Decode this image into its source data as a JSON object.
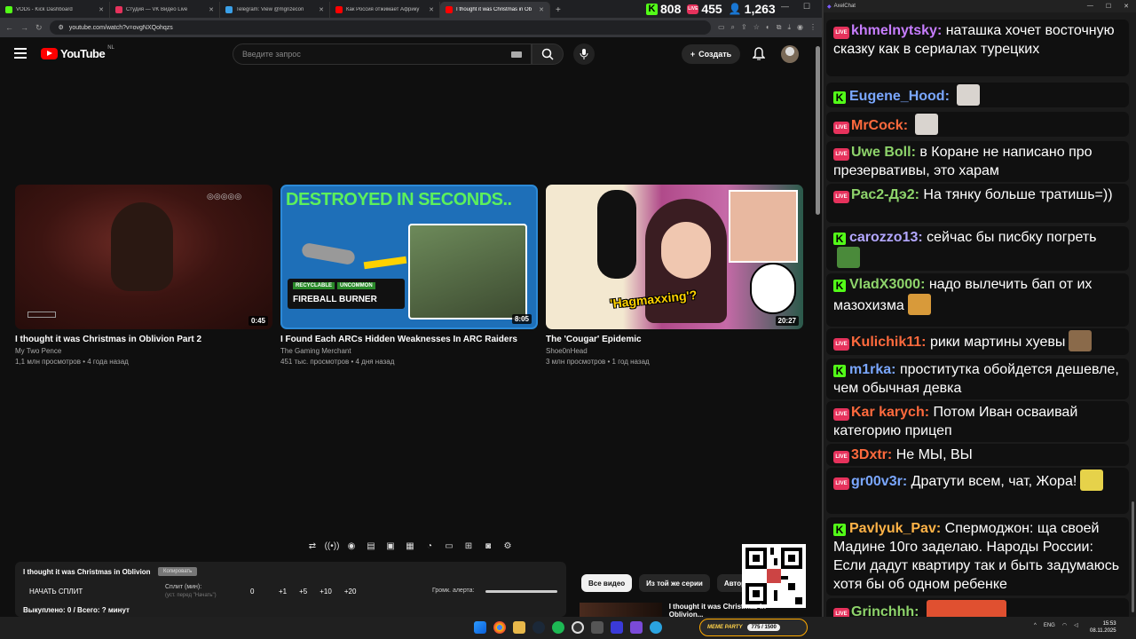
{
  "browser": {
    "tabs": [
      {
        "title": "VODs - Kick Dashboard",
        "fav": "#53fc18",
        "active": false
      },
      {
        "title": "Студия — VK Видео Live",
        "fav": "#e6325c",
        "active": false
      },
      {
        "title": "Telegram: View @mgnzecon",
        "fav": "#3aa0e8",
        "active": false
      },
      {
        "title": "Как Россия отжимает Африку",
        "fav": "#ff0000",
        "active": false
      },
      {
        "title": "I thought it was Christmas in Ob",
        "fav": "#ff0000",
        "active": true
      }
    ],
    "url": "youtube.com/watch?v=ovgNXQohqzs"
  },
  "stream_stats": {
    "kick_viewers": "808",
    "vk_viewers": "455",
    "total_viewers": "1,263"
  },
  "youtube": {
    "logo_text": "YouTube",
    "logo_region": "NL",
    "search_placeholder": "Введите запрос",
    "create_label": "Создать",
    "videos": [
      {
        "title": "I thought it was Christmas in Oblivion Part 2",
        "channel": "My Two Pence",
        "meta": "1,1 млн просмотров • 4 года назад",
        "duration": "0:45"
      },
      {
        "title": "I Found Each ARCs Hidden Weaknesses In ARC Raiders",
        "channel": "The Gaming Merchant",
        "meta": "451 тыс. просмотров • 4 дня назад",
        "duration": "8:05",
        "thumb_headline": "DESTROYED IN SECONDS..",
        "thumb_tag1": "RECYCLABLE",
        "thumb_tag2": "UNCOMMON",
        "thumb_item": "FIREBALL BURNER"
      },
      {
        "title": "The 'Cougar' Epidemic",
        "channel": "Shoe0nHead",
        "meta": "3 млн просмотров • 1 год назад",
        "duration": "20:27",
        "thumb_caption": "'Hagmaxxing'?"
      }
    ],
    "panel": {
      "title": "I thought it was Christmas in Oblivion",
      "copy_label": "Копировать",
      "start_label": "НАЧАТЬ СПЛИТ",
      "split_label": "Сплит (мин):",
      "split_sub": "(уст. перед \"Начать\")",
      "split_value": "0",
      "increments": [
        "+1",
        "+5",
        "+10",
        "+20"
      ],
      "alert_label": "Громк. алерта:",
      "alert_volume": 1.0,
      "bought": "Выкуплено: 0 / Всего: ? минут"
    },
    "chips": [
      "Все видео",
      "Из той же серии",
      "Автор:"
    ],
    "next_title": "I thought it was Christmas in Oblivion..."
  },
  "chat": {
    "app_title": "AxelChat",
    "messages": [
      {
        "platform": "vk",
        "nick": "khmelnytsky",
        "color": "#c77dff",
        "text": "наташка хочет восточную сказку как в сериалах турецких"
      },
      {
        "platform": "kick",
        "nick": "Eugene_Hood",
        "color": "#7aa7ff",
        "text": "",
        "emote": "#d9d4cf"
      },
      {
        "platform": "vk",
        "nick": "MrCock",
        "color": "#ff6a3d",
        "text": "",
        "emote": "#d9d4cf"
      },
      {
        "platform": "vk",
        "nick": "Uwe Boll",
        "color": "#8ed46b",
        "text": "в Коране не написано про презервативы, это харам"
      },
      {
        "platform": "vk",
        "nick": "Рас2-Дэ2",
        "color": "#8ed46b",
        "text": "На тянку больше тратишь=))"
      },
      {
        "platform": "kick",
        "nick": "carozzo13",
        "color": "#b3a7ff",
        "text": "сейчас бы писбку погреть",
        "emote": "#4a8a3a"
      },
      {
        "platform": "kick",
        "nick": "VladX3000",
        "color": "#8ed46b",
        "text": "надо вылечить бап от их мазохизма",
        "emote": "#d89a3a"
      },
      {
        "platform": "vk",
        "nick": "Kulichik11",
        "color": "#ff6a3d",
        "text": "рики мартины хуевы",
        "emote": "#8a6a4a"
      },
      {
        "platform": "kick",
        "nick": "m1rka",
        "color": "#7aa7ff",
        "text": "проститутка обойдется дешевле, чем обычная девка"
      },
      {
        "platform": "vk",
        "nick": "Kar karych",
        "color": "#ff6a3d",
        "text": "Потом Иван осваивай категорию прицеп"
      },
      {
        "platform": "vk",
        "nick": "3Dxtr",
        "color": "#ff6a3d",
        "text": "Не МЫ, ВЫ"
      },
      {
        "platform": "vk",
        "nick": "gr00v3r",
        "color": "#7aa7ff",
        "text": "Дратути всем, чат, Жора!",
        "emote": "#e6d24a"
      },
      {
        "platform": "kick",
        "nick": "Pavlyuk_Pav",
        "color": "#ffb347",
        "text": "Спермоджон: ща своей Мадине 10го заделаю. Народы России: Если дадут квартиру так и быть задумаюсь хотя бы об одном ребенке"
      },
      {
        "platform": "vk",
        "nick": "Grinchhh",
        "color": "#8ed46b",
        "text": "",
        "emote": "#e05030"
      }
    ]
  },
  "taskbar": {
    "lang": "ENG",
    "time": "15:53",
    "date": "08.11.2025",
    "meme_label": "MEME PARTY",
    "meme_count": "775 / 1500"
  }
}
